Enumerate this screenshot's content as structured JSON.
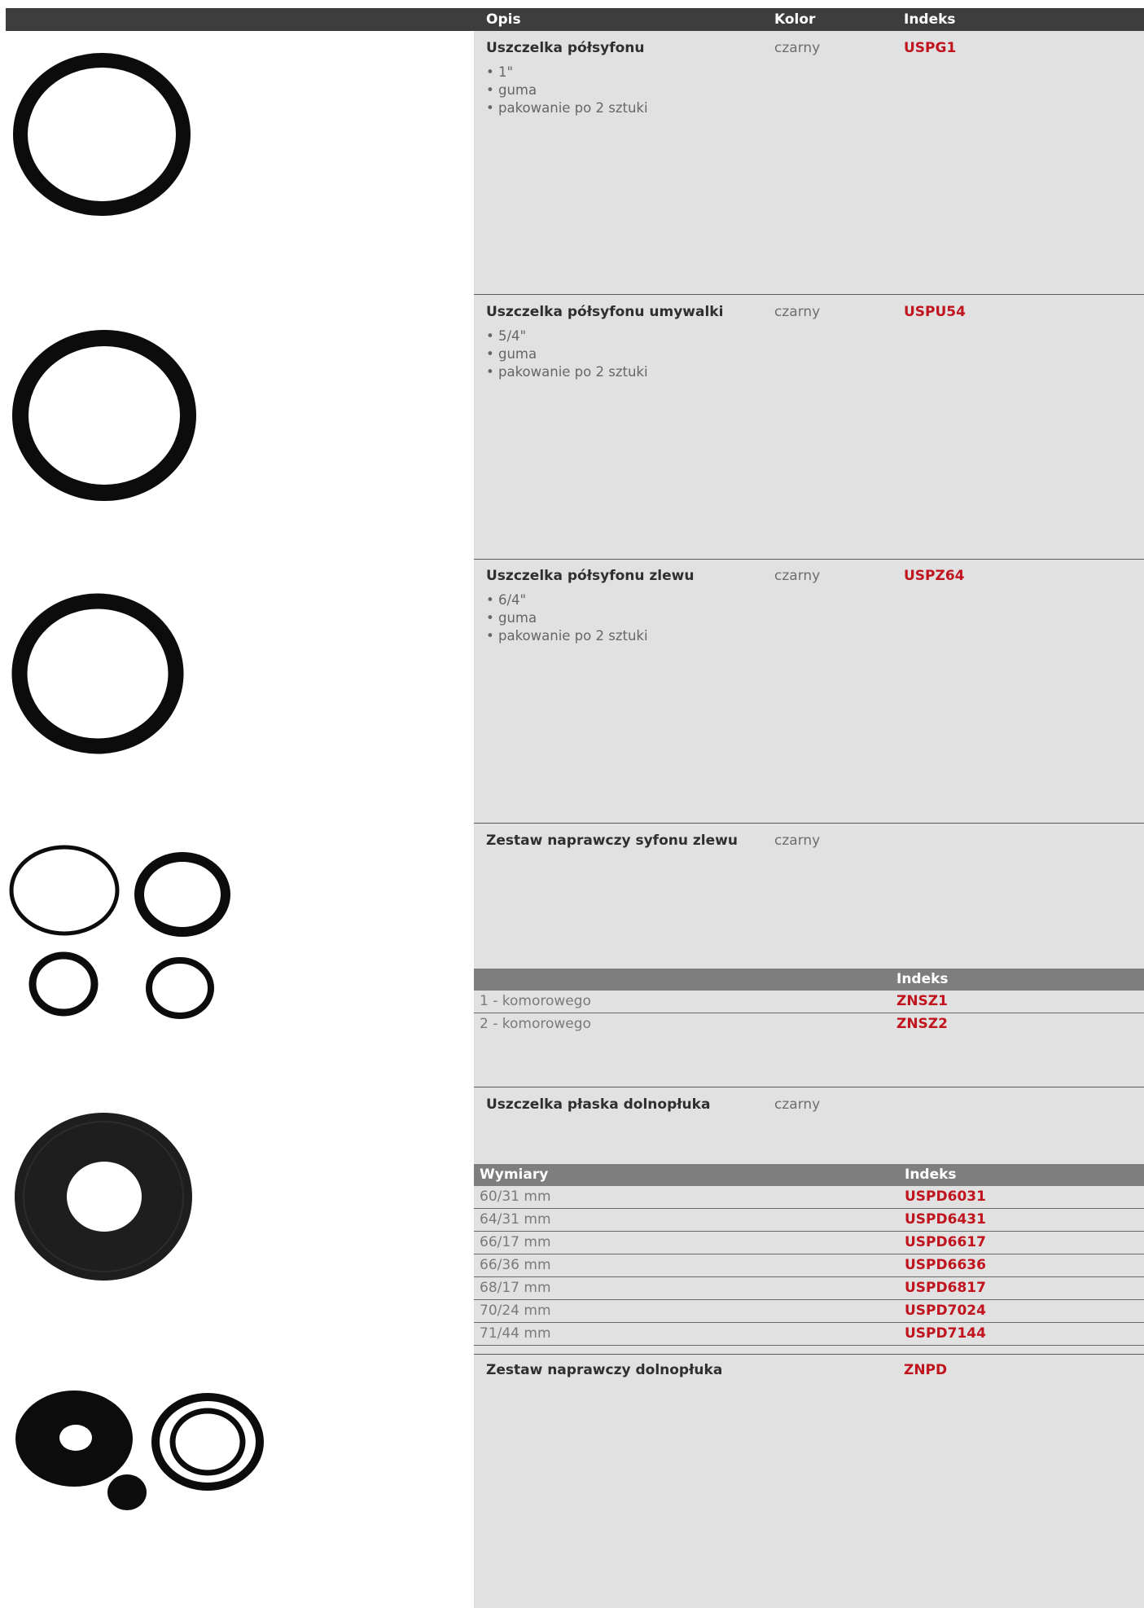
{
  "header": {
    "col_desc": "Opis",
    "col_color": "Kolor",
    "col_index": "Indeks"
  },
  "products": [
    {
      "name": "Uszczelka półsyfonu",
      "color": "czarny",
      "index": "USPG1",
      "bullets": [
        "1\"",
        "guma",
        "pakowanie po 2 sztuki"
      ]
    },
    {
      "name": "Uszczelka półsyfonu umywalki",
      "color": "czarny",
      "index": "USPU54",
      "bullets": [
        "5/4\"",
        "guma",
        "pakowanie po 2 sztuki"
      ]
    },
    {
      "name": "Uszczelka półsyfonu zlewu",
      "color": "czarny",
      "index": "USPZ64",
      "bullets": [
        "6/4\"",
        "guma",
        "pakowanie po 2 sztuki"
      ]
    },
    {
      "name": "Zestaw naprawczy syfonu zlewu",
      "color": "czarny",
      "subtable": {
        "col_index": "Indeks",
        "rows": [
          {
            "label": "1 - komorowego",
            "index": "ZNSZ1"
          },
          {
            "label": "2 - komorowego",
            "index": "ZNSZ2"
          }
        ]
      }
    },
    {
      "name": "Uszczelka płaska dolnopłuka",
      "color": "czarny",
      "subtable": {
        "col_dim": "Wymiary",
        "col_index": "Indeks",
        "rows": [
          {
            "label": "60/31 mm",
            "index": "USPD6031"
          },
          {
            "label": "64/31 mm",
            "index": "USPD6431"
          },
          {
            "label": "66/17 mm",
            "index": "USPD6617"
          },
          {
            "label": "66/36 mm",
            "index": "USPD6636"
          },
          {
            "label": "68/17 mm",
            "index": "USPD6817"
          },
          {
            "label": "70/24 mm",
            "index": "USPD7024"
          },
          {
            "label": "71/44 mm",
            "index": "USPD7144"
          }
        ]
      }
    },
    {
      "name": "Zestaw naprawczy dolnopłuka",
      "index": "ZNPD"
    }
  ],
  "colors": {
    "header_bg": "#3d3d3d",
    "panel_bg": "#e1e1e1",
    "subheader_bg": "#7e7e7e",
    "index_red": "#c0141f"
  }
}
